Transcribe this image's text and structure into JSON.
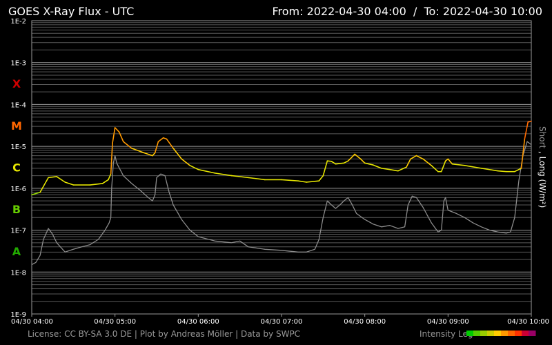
{
  "chart_data": {
    "type": "line",
    "title": "GOES X-Ray Flux - UTC",
    "range_text": "From: 2022-04-30 04:00  /  To: 2022-04-30 10:00",
    "y_scale": "log",
    "ylim": [
      1e-09,
      0.01
    ],
    "y_ticks": [
      "1E-2",
      "1E-3",
      "1E-4",
      "1E-5",
      "1E-6",
      "1E-7",
      "1E-8",
      "1E-9"
    ],
    "x_tick_labels": [
      "04/30 04:00",
      "04/30 05:00",
      "04/30 06:00",
      "04/30 07:00",
      "04/30 08:00",
      "04/30 09:00",
      "04/30 10:00"
    ],
    "xlim_hours": [
      0,
      6
    ],
    "flare_classes": [
      {
        "label": "X",
        "color": "#cc0000",
        "exp": -3.5
      },
      {
        "label": "M",
        "color": "#ff6600",
        "exp": -4.5
      },
      {
        "label": "C",
        "color": "#e6e600",
        "exp": -5.5
      },
      {
        "label": "B",
        "color": "#66cc00",
        "exp": -6.5
      },
      {
        "label": "A",
        "color": "#22aa00",
        "exp": -7.5
      }
    ],
    "ylabel_short": "Short",
    "ylabel_sep": " , ",
    "ylabel_long": "Long (W/m²)",
    "series": [
      {
        "name": "Long",
        "color_by_level": true,
        "points": [
          [
            0.0,
            7e-07
          ],
          [
            0.1,
            8e-07
          ],
          [
            0.2,
            1.8e-06
          ],
          [
            0.3,
            1.9e-06
          ],
          [
            0.4,
            1.4e-06
          ],
          [
            0.5,
            1.2e-06
          ],
          [
            0.7,
            1.2e-06
          ],
          [
            0.85,
            1.3e-06
          ],
          [
            0.92,
            1.6e-06
          ],
          [
            0.95,
            2.2e-06
          ],
          [
            0.97,
            1.2e-05
          ],
          [
            1.0,
            2.8e-05
          ],
          [
            1.05,
            2.2e-05
          ],
          [
            1.1,
            1.3e-05
          ],
          [
            1.2,
            9e-06
          ],
          [
            1.35,
            7e-06
          ],
          [
            1.45,
            6e-06
          ],
          [
            1.48,
            7e-06
          ],
          [
            1.52,
            1.3e-05
          ],
          [
            1.58,
            1.6e-05
          ],
          [
            1.62,
            1.5e-05
          ],
          [
            1.7,
            9e-06
          ],
          [
            1.8,
            5e-06
          ],
          [
            1.9,
            3.5e-06
          ],
          [
            2.0,
            2.8e-06
          ],
          [
            2.2,
            2.3e-06
          ],
          [
            2.4,
            2e-06
          ],
          [
            2.6,
            1.8e-06
          ],
          [
            2.8,
            1.6e-06
          ],
          [
            3.0,
            1.6e-06
          ],
          [
            3.2,
            1.5e-06
          ],
          [
            3.3,
            1.4e-06
          ],
          [
            3.45,
            1.5e-06
          ],
          [
            3.5,
            2e-06
          ],
          [
            3.55,
            4.5e-06
          ],
          [
            3.6,
            4.4e-06
          ],
          [
            3.65,
            3.8e-06
          ],
          [
            3.75,
            4e-06
          ],
          [
            3.8,
            4.5e-06
          ],
          [
            3.88,
            6.5e-06
          ],
          [
            3.95,
            5e-06
          ],
          [
            4.0,
            4e-06
          ],
          [
            4.1,
            3.6e-06
          ],
          [
            4.2,
            3e-06
          ],
          [
            4.3,
            2.8e-06
          ],
          [
            4.4,
            2.6e-06
          ],
          [
            4.5,
            3.2e-06
          ],
          [
            4.55,
            5e-06
          ],
          [
            4.62,
            6e-06
          ],
          [
            4.7,
            5e-06
          ],
          [
            4.8,
            3.5e-06
          ],
          [
            4.88,
            2.5e-06
          ],
          [
            4.92,
            2.5e-06
          ],
          [
            4.97,
            4.5e-06
          ],
          [
            5.0,
            5e-06
          ],
          [
            5.05,
            3.8e-06
          ],
          [
            5.2,
            3.5e-06
          ],
          [
            5.4,
            3e-06
          ],
          [
            5.6,
            2.6e-06
          ],
          [
            5.7,
            2.5e-06
          ],
          [
            5.8,
            2.5e-06
          ],
          [
            5.88,
            3e-06
          ],
          [
            5.92,
            1.5e-05
          ],
          [
            5.96,
            3.8e-05
          ],
          [
            6.0,
            4e-05
          ]
        ]
      },
      {
        "name": "Short",
        "color": "#8c8c8c",
        "points": [
          [
            0.0,
            1.5e-08
          ],
          [
            0.05,
            1.7e-08
          ],
          [
            0.1,
            2.5e-08
          ],
          [
            0.14,
            6e-08
          ],
          [
            0.2,
            1.1e-07
          ],
          [
            0.25,
            8e-08
          ],
          [
            0.3,
            5e-08
          ],
          [
            0.4,
            3e-08
          ],
          [
            0.5,
            3.5e-08
          ],
          [
            0.6,
            4e-08
          ],
          [
            0.7,
            4.5e-08
          ],
          [
            0.8,
            6e-08
          ],
          [
            0.88,
            1e-07
          ],
          [
            0.93,
            1.5e-07
          ],
          [
            0.95,
            2e-07
          ],
          [
            0.96,
            1e-06
          ],
          [
            0.98,
            4e-06
          ],
          [
            1.0,
            6e-06
          ],
          [
            1.02,
            4e-06
          ],
          [
            1.1,
            2e-06
          ],
          [
            1.2,
            1.3e-06
          ],
          [
            1.3,
            9e-07
          ],
          [
            1.4,
            6e-07
          ],
          [
            1.45,
            5e-07
          ],
          [
            1.48,
            7e-07
          ],
          [
            1.5,
            1.8e-06
          ],
          [
            1.55,
            2.2e-06
          ],
          [
            1.6,
            2e-06
          ],
          [
            1.65,
            8e-07
          ],
          [
            1.7,
            4e-07
          ],
          [
            1.8,
            1.8e-07
          ],
          [
            1.9,
            1e-07
          ],
          [
            2.0,
            7e-08
          ],
          [
            2.2,
            5.5e-08
          ],
          [
            2.4,
            5e-08
          ],
          [
            2.5,
            5.5e-08
          ],
          [
            2.6,
            4e-08
          ],
          [
            2.8,
            3.5e-08
          ],
          [
            3.0,
            3.3e-08
          ],
          [
            3.2,
            3e-08
          ],
          [
            3.3,
            3e-08
          ],
          [
            3.4,
            3.5e-08
          ],
          [
            3.45,
            6e-08
          ],
          [
            3.5,
            2e-07
          ],
          [
            3.55,
            5e-07
          ],
          [
            3.6,
            4e-07
          ],
          [
            3.65,
            3.3e-07
          ],
          [
            3.7,
            4e-07
          ],
          [
            3.75,
            5e-07
          ],
          [
            3.8,
            6e-07
          ],
          [
            3.85,
            4e-07
          ],
          [
            3.9,
            2.5e-07
          ],
          [
            4.0,
            1.8e-07
          ],
          [
            4.1,
            1.4e-07
          ],
          [
            4.2,
            1.2e-07
          ],
          [
            4.3,
            1.3e-07
          ],
          [
            4.4,
            1.1e-07
          ],
          [
            4.48,
            1.2e-07
          ],
          [
            4.52,
            4e-07
          ],
          [
            4.57,
            6.5e-07
          ],
          [
            4.62,
            6e-07
          ],
          [
            4.7,
            3.5e-07
          ],
          [
            4.8,
            1.5e-07
          ],
          [
            4.88,
            9e-08
          ],
          [
            4.92,
            1e-07
          ],
          [
            4.95,
            5e-07
          ],
          [
            4.97,
            6e-07
          ],
          [
            5.0,
            3e-07
          ],
          [
            5.1,
            2.5e-07
          ],
          [
            5.2,
            2e-07
          ],
          [
            5.3,
            1.5e-07
          ],
          [
            5.4,
            1.2e-07
          ],
          [
            5.5,
            1e-07
          ],
          [
            5.6,
            9e-08
          ],
          [
            5.7,
            8.5e-08
          ],
          [
            5.75,
            9e-08
          ],
          [
            5.8,
            2e-07
          ],
          [
            5.85,
            1.5e-06
          ],
          [
            5.9,
            6e-06
          ],
          [
            5.95,
            1.3e-05
          ],
          [
            6.0,
            1.1e-05
          ]
        ]
      }
    ],
    "grid": true
  },
  "footer": {
    "license": "License: CC BY-SA 3.0 DE | Plot by Andreas Möller | Data by SWPC",
    "intensity_legend": "Intensity Leg",
    "intensity_colors": [
      "#00cc00",
      "#55cc00",
      "#99cc00",
      "#cccc00",
      "#ffcc00",
      "#ff9900",
      "#ff6600",
      "#ff3300",
      "#cc0033",
      "#990066"
    ]
  }
}
